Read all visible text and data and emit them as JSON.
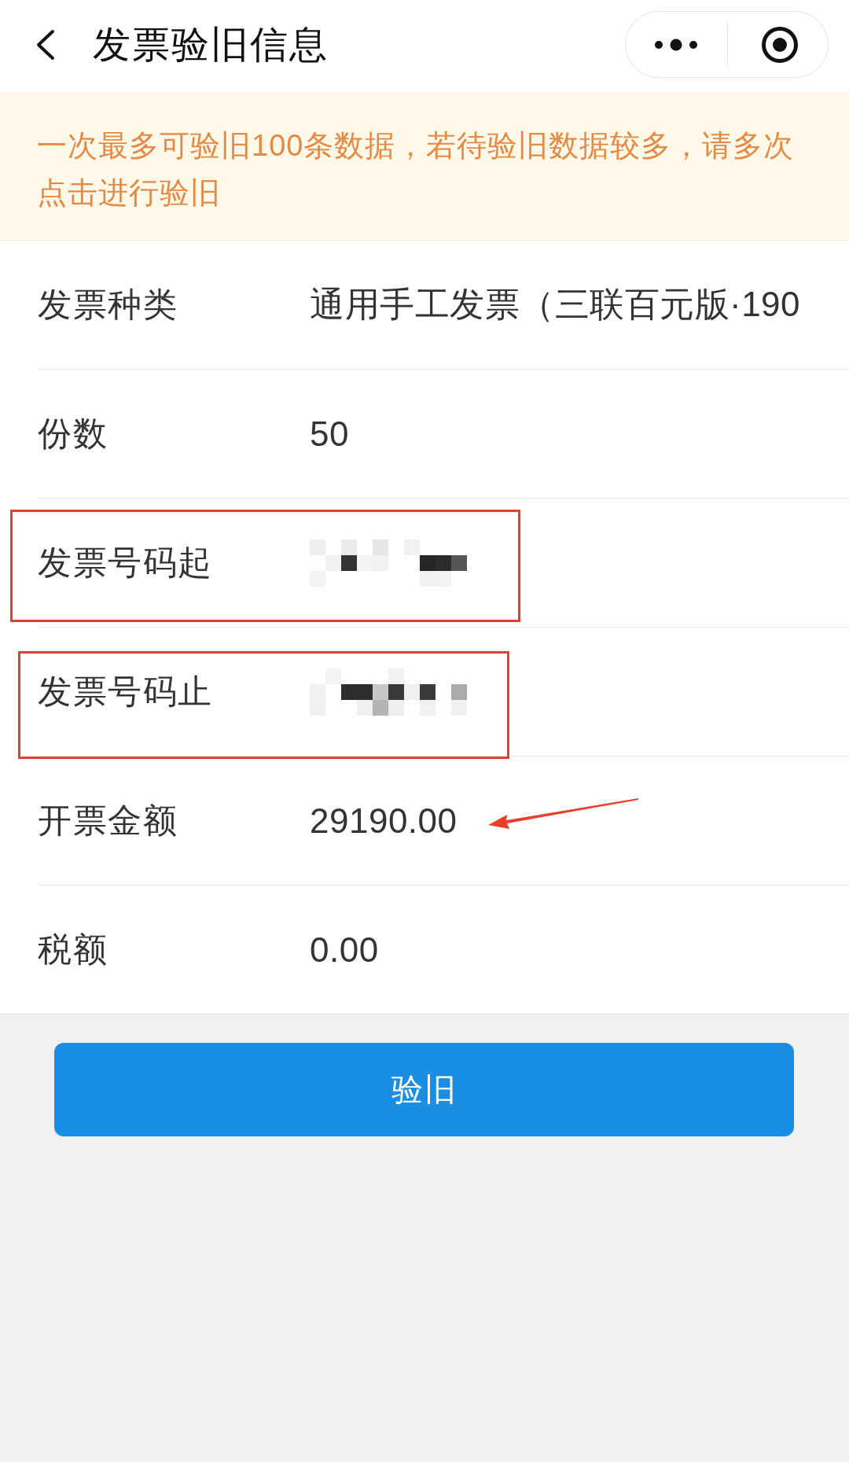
{
  "nav": {
    "title": "发票验旧信息"
  },
  "notice": {
    "text": "一次最多可验旧100条数据，若待验旧数据较多，请多次点击进行验旧"
  },
  "rows": [
    {
      "label": "发票种类",
      "kind": "text",
      "value": "通用手工发票（三联百元版·190",
      "highlighted": false,
      "arrow": false
    },
    {
      "label": "份数",
      "kind": "text",
      "value": "50",
      "highlighted": false,
      "arrow": false
    },
    {
      "label": "发票号码起",
      "kind": "redacted",
      "highlighted": true,
      "arrow": false
    },
    {
      "label": "发票号码止",
      "kind": "redacted",
      "highlighted": true,
      "arrow": false
    },
    {
      "label": "开票金额",
      "kind": "text",
      "value": "29190.00",
      "highlighted": false,
      "arrow": true
    },
    {
      "label": "税额",
      "kind": "text",
      "value": "0.00",
      "highlighted": false,
      "arrow": false
    }
  ],
  "button": {
    "label": "验旧"
  }
}
